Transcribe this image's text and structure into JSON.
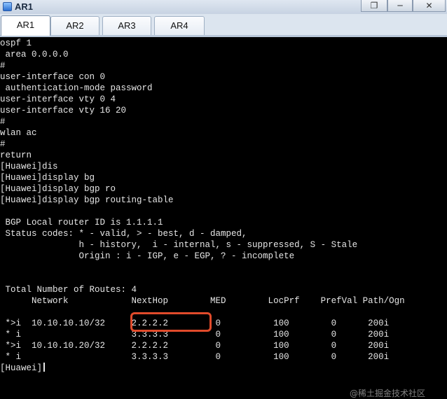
{
  "window": {
    "title": "AR1"
  },
  "window_controls": {
    "restore": "❐",
    "minimize": "─",
    "close": "✕"
  },
  "tabs": [
    {
      "label": "AR1",
      "active": true
    },
    {
      "label": "AR2",
      "active": false
    },
    {
      "label": "AR3",
      "active": false
    },
    {
      "label": "AR4",
      "active": false
    }
  ],
  "console": {
    "lines": [
      "ospf 1",
      " area 0.0.0.0",
      "#",
      "user-interface con 0",
      " authentication-mode password",
      "user-interface vty 0 4",
      "user-interface vty 16 20",
      "#",
      "wlan ac",
      "#",
      "return",
      "[Huawei]dis",
      "[Huawei]display bg",
      "[Huawei]display bgp ro",
      "[Huawei]display bgp routing-table",
      "",
      " BGP Local router ID is 1.1.1.1",
      " Status codes: * - valid, > - best, d - damped,",
      "               h - history,  i - internal, s - suppressed, S - Stale",
      "               Origin : i - IGP, e - EGP, ? - incomplete",
      "",
      "",
      " Total Number of Routes: 4",
      "      Network            NextHop        MED        LocPrf    PrefVal Path/Ogn",
      "",
      " *>i  10.10.10.10/32     2.2.2.2         0          100        0      200i",
      " * i                     3.3.3.3         0          100        0      200i",
      " *>i  10.10.10.20/32     2.2.2.2         0          100        0      200i",
      " * i                     3.3.3.3         0          100        0      200i",
      "[Huawei]"
    ]
  },
  "colors": {
    "console_bg": "#000000",
    "console_fg": "#e6e6e6",
    "highlight": "#e14b2b"
  },
  "watermark": "@稀土掘金技术社区"
}
